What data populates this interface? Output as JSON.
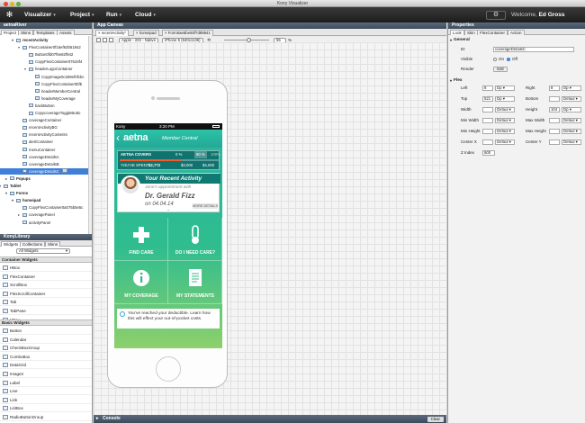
{
  "window": {
    "title": "Kony Visualizer"
  },
  "menubar": {
    "items": [
      {
        "label": "Visualizer"
      },
      {
        "label": "Project"
      },
      {
        "label": "Run"
      },
      {
        "label": "Cloud"
      }
    ],
    "welcome_prefix": "Welcome,",
    "user_name": "Ed Gross"
  },
  "left": {
    "project_name": "aetnaRiver",
    "tabs": [
      "Project",
      "Skins",
      "Templates",
      "Assets"
    ],
    "tree": [
      {
        "label": "recentActivity",
        "level": 1,
        "bold": true
      },
      {
        "label": "FlexContainer0f16ef62b51842",
        "level": 2
      },
      {
        "label": "Button0fd07f6e82f942",
        "level": 3
      },
      {
        "label": "CopyFlexContainer07634f4",
        "level": 3
      },
      {
        "label": "headerLogoContainer",
        "level": 3
      },
      {
        "label": "CopyImage0c269ef0fcbc",
        "level": 4
      },
      {
        "label": "CopyFlexContainer0bfb",
        "level": 4
      },
      {
        "label": "headerMemberCentral",
        "level": 4
      },
      {
        "label": "headerMyCoverage",
        "level": 4
      },
      {
        "label": "backButton",
        "level": 3
      },
      {
        "label": "CopycoverageToggleButto",
        "level": 3
      },
      {
        "label": "coverageContainer",
        "level": 2
      },
      {
        "label": "recentActivityBG",
        "level": 2
      },
      {
        "label": "recentActivityContents",
        "level": 2
      },
      {
        "label": "alertContainer",
        "level": 2
      },
      {
        "label": "menuContainer",
        "level": 2
      },
      {
        "label": "coverageDetailsA",
        "level": 2
      },
      {
        "label": "coverageDetailsB",
        "level": 2
      },
      {
        "label": "coverageDetailsC",
        "level": 2,
        "selected": true
      },
      {
        "label": "Popups",
        "level": 0,
        "bold": true
      },
      {
        "label": "Tablet",
        "level": -1,
        "bold": true
      },
      {
        "label": "Forms",
        "level": 0,
        "bold": true
      },
      {
        "label": "homeipad",
        "level": 1,
        "bold": true
      },
      {
        "label": "CopyFlexContainer0a075b5e5c",
        "level": 2
      },
      {
        "label": "coveragePanel",
        "level": 2
      },
      {
        "label": "activityPanel",
        "level": 2
      }
    ],
    "library": {
      "title": "KonyLibrary",
      "tabs": [
        "Widgets",
        "Collections",
        "Skins"
      ],
      "filter": "All Widgets",
      "container_header": "Container Widgets",
      "container_widgets": [
        "HBox",
        "FlexContainer",
        "ScrollBox",
        "FlexScrollContainer",
        "Tab",
        "TabPane",
        "VBox"
      ],
      "basic_header": "Basic Widgets",
      "basic_widgets": [
        "Button",
        "Calendar",
        "CheckBoxGroup",
        "ComboBox",
        "DataGrid",
        "Image2",
        "Label",
        "Line",
        "Link",
        "ListBox",
        "RadioButtonGroup",
        "RichText"
      ]
    }
  },
  "canvas": {
    "title": "App Canvas",
    "tabs": [
      "recentActivity*",
      "homeipad",
      "Form0ae5be50f7d89841"
    ],
    "platform": "Apple - iOS - Native",
    "device": "iPhone 5 (640x1136)",
    "zoom": "55",
    "zoom_unit": "%",
    "console_label": "Console",
    "clear_label": "Clear",
    "phone": {
      "carrier": "Kony",
      "time": "3:20 PM",
      "brand": "aetna",
      "member_central": "Member Central",
      "coverage_label": "AETNA COVERS",
      "cov_pct_a": "0 %",
      "cov_pct_b": "80 %",
      "cov_pct_c": "100%",
      "coverage_fraction": 0.62,
      "spent_label": "YOU'VE SPENT:",
      "spent_value": "$2,772",
      "spent_b": "$3,000",
      "spent_c": "$4,000",
      "recent_title": "Your Recent Activity",
      "appt_text": "Jane's appointment with",
      "doctor": "Dr. Gerald Fizz",
      "appt_date": "on 04.04.14",
      "more_details": "MORE DETAILS",
      "tiles": [
        "FIND CARE",
        "DO I NEED CARE?",
        "MY COVERAGE",
        "MY STATEMENTS"
      ],
      "info": "You've reached your deductible.  Learn how this will effect your out-of-pocket costs."
    }
  },
  "properties": {
    "title": "Properties",
    "tabs": [
      "Look",
      "Skin",
      "FlexContainer",
      "Action"
    ],
    "general_label": "General",
    "id_label": "ID",
    "id_value": "coverageDetailsC",
    "visible_label": "Visible",
    "on_label": "On",
    "off_label": "Off",
    "render_label": "Render",
    "edit_label": "Edit",
    "flex_label": "Flex",
    "left_label": "Left",
    "left_value": "8",
    "left_unit": "Dp",
    "right_label": "Right",
    "right_value": "8",
    "right_unit": "Dp",
    "top_label": "Top",
    "top_value": "521",
    "top_unit": "Dp",
    "bottom_label": "Bottom",
    "bottom_unit": "Defaul",
    "width_label": "Width",
    "width_unit": "Defaul",
    "height_label": "Height",
    "height_value": "104",
    "height_unit": "Dp",
    "minwidth_label": "Min Width",
    "minwidth_unit": "Defaul",
    "maxwidth_label": "Max Width",
    "maxwidth_unit": "Defaul",
    "minheight_label": "Min Height",
    "minheight_unit": "Defaul",
    "maxheight_label": "Max Height",
    "maxheight_unit": "Defaul",
    "centerx_label": "Center X",
    "centerx_unit": "Defaul",
    "centery_label": "Center Y",
    "centery_unit": "Defaul",
    "zindex_label": "Z Index",
    "zindex_value": "500"
  }
}
